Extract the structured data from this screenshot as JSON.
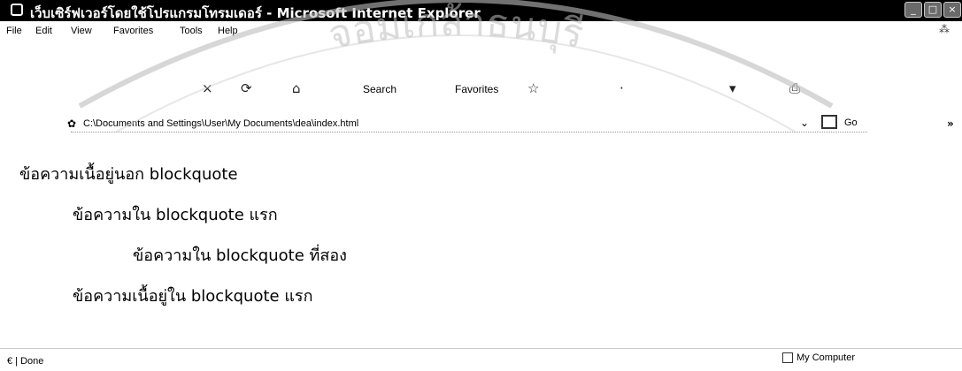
{
  "window": {
    "title": "เว็บเซิร์ฟเวอร์โดยใช้โปรแกรมโทรมเดอร์ - Microsoft Internet Explorer",
    "controls": [
      "minimize",
      "maximize",
      "close"
    ]
  },
  "menu": {
    "items": [
      "File",
      "Edit",
      "View",
      "Favorites",
      "Tools",
      "Help"
    ]
  },
  "toolbar": {
    "search_label": "Search",
    "favorites_label": "Favorites"
  },
  "address": {
    "value": "C:\\Documents and Settings\\User\\My Documents\\dea\\index.html",
    "go_label": "Go"
  },
  "content": {
    "outside_text": "ข้อความเนื้อยู่นอก blockquote",
    "first_bq_text": "ข้อความใน blockquote แรก",
    "second_bq_text": "ข้อความใน blockquote ที่สอง",
    "first_bq_after_text": "ข้อความเนื้อยู่ใน blockquote แรก"
  },
  "status": {
    "left_text": "Done",
    "zone_text": "My Computer"
  },
  "watermark": {
    "text": "จอมเกล้าธนบุรี"
  }
}
